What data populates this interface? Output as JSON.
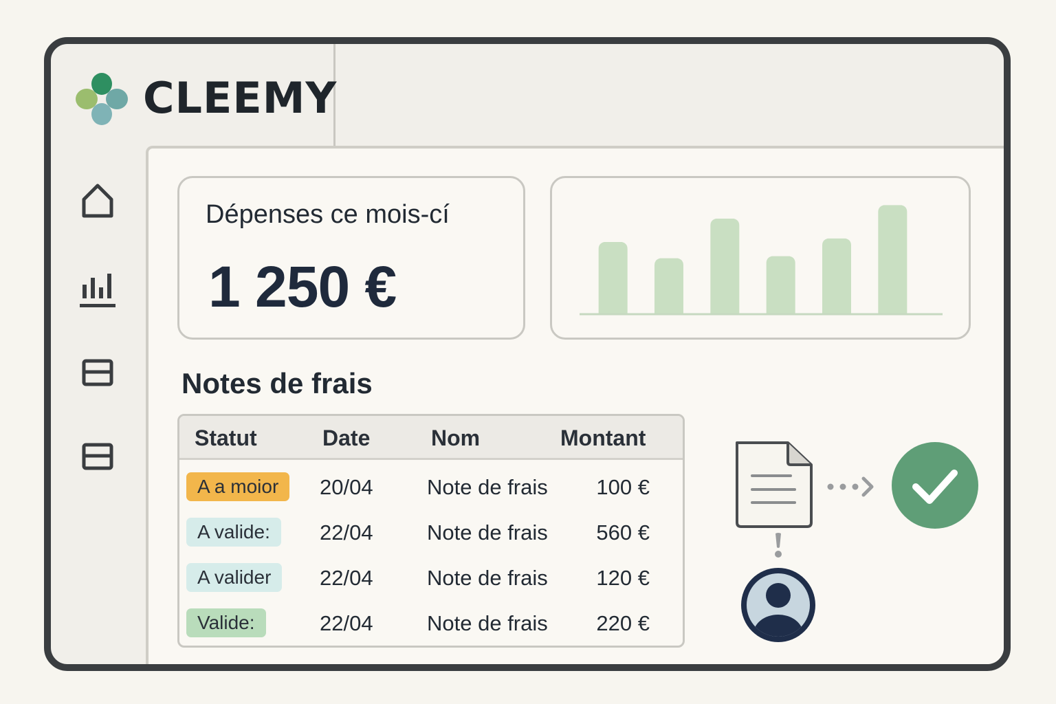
{
  "app": {
    "name": "CLEEMY"
  },
  "sidebar": {
    "items": [
      {
        "icon": "home-icon"
      },
      {
        "icon": "bar-chart-icon"
      },
      {
        "icon": "list-icon"
      },
      {
        "icon": "list-icon"
      }
    ]
  },
  "summary": {
    "title": "Dépenses ce mois-cí",
    "value": "1 250 €"
  },
  "chart_data": {
    "type": "bar",
    "categories": [
      "",
      "",
      "",
      "",
      "",
      ""
    ],
    "values": [
      100,
      77,
      133,
      80,
      105,
      152
    ],
    "title": "",
    "xlabel": "",
    "ylabel": "",
    "ylim": [
      0,
      165
    ],
    "grid": false,
    "bar_color": "#c9dfc2"
  },
  "expenses": {
    "title": "Notes de frais",
    "columns": [
      "Statut",
      "Date",
      "Nom",
      "Montant"
    ],
    "rows": [
      {
        "status": "A a moior",
        "status_color": "#f2b64b",
        "date": "20/04",
        "name": "Note de frais",
        "amount": "100 €"
      },
      {
        "status": "A valide:",
        "status_color": "#d6ecea",
        "date": "22/04",
        "name": "Note de frais",
        "amount": "560 €"
      },
      {
        "status": "A valider",
        "status_color": "#d6ecea",
        "date": "22/04",
        "name": "Note de frais",
        "amount": "120 €"
      },
      {
        "status": "Valide:",
        "status_color": "#b9dcbb",
        "date": "22/04",
        "name": "Note de frais",
        "amount": "220 €"
      }
    ]
  },
  "workflow": {
    "document_icon": "document-icon",
    "approved_icon": "check-circle-icon",
    "user_icon": "user-avatar-icon",
    "approved_color": "#5f9e77"
  }
}
